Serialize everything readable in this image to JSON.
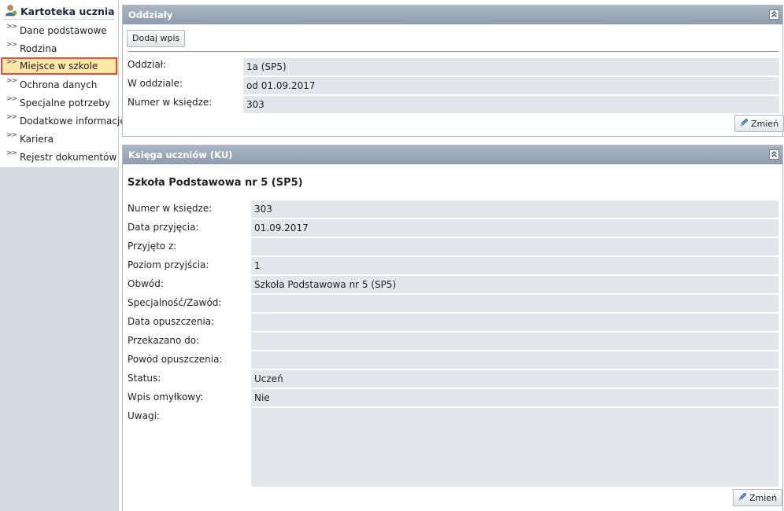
{
  "sidebar": {
    "title": "Kartoteka ucznia",
    "items": [
      {
        "label": "Dane podstawowe"
      },
      {
        "label": "Rodzina"
      },
      {
        "label": "Miejsce w szkole"
      },
      {
        "label": "Ochrona danych"
      },
      {
        "label": "Specjalne potrzeby"
      },
      {
        "label": "Dodatkowe informacje"
      },
      {
        "label": "Kariera"
      },
      {
        "label": "Rejestr dokumentów"
      }
    ],
    "active_index": 2
  },
  "oddzialy": {
    "title": "Oddziały",
    "add_button": "Dodaj wpis",
    "rows": [
      {
        "label": "Oddział:",
        "value": "1a (SP5)"
      },
      {
        "label": "W oddziale:",
        "value": "od 01.09.2017"
      },
      {
        "label": "Numer w księdze:",
        "value": "303"
      }
    ],
    "edit_button": "Zmień"
  },
  "ksiega": {
    "title": "Księga uczniów (KU)",
    "school": "Szkoła Podstawowa nr 5 (SP5)",
    "rows": [
      {
        "label": "Numer w księdze:",
        "value": "303"
      },
      {
        "label": "Data przyjęcia:",
        "value": "01.09.2017"
      },
      {
        "label": "Przyjęto z:",
        "value": ""
      },
      {
        "label": "Poziom przyjścia:",
        "value": "1"
      },
      {
        "label": "Obwód:",
        "value": "Szkoła Podstawowa nr 5 (SP5)"
      },
      {
        "label": "Specjalność/Zawód:",
        "value": ""
      },
      {
        "label": "Data opuszczenia:",
        "value": ""
      },
      {
        "label": "Przekazano do:",
        "value": ""
      },
      {
        "label": "Powód opuszczenia:",
        "value": ""
      },
      {
        "label": "Status:",
        "value": "Uczeń"
      },
      {
        "label": "Wpis omyłkowy:",
        "value": "Nie"
      },
      {
        "label": "Uwagi:",
        "value": ""
      }
    ],
    "edit_button": "Zmień"
  },
  "icons": {
    "user": "user-icon",
    "nav_arrow": "double-chevron-right-icon",
    "collapse": "double-chevron-up-icon",
    "pencil": "pencil-icon"
  }
}
